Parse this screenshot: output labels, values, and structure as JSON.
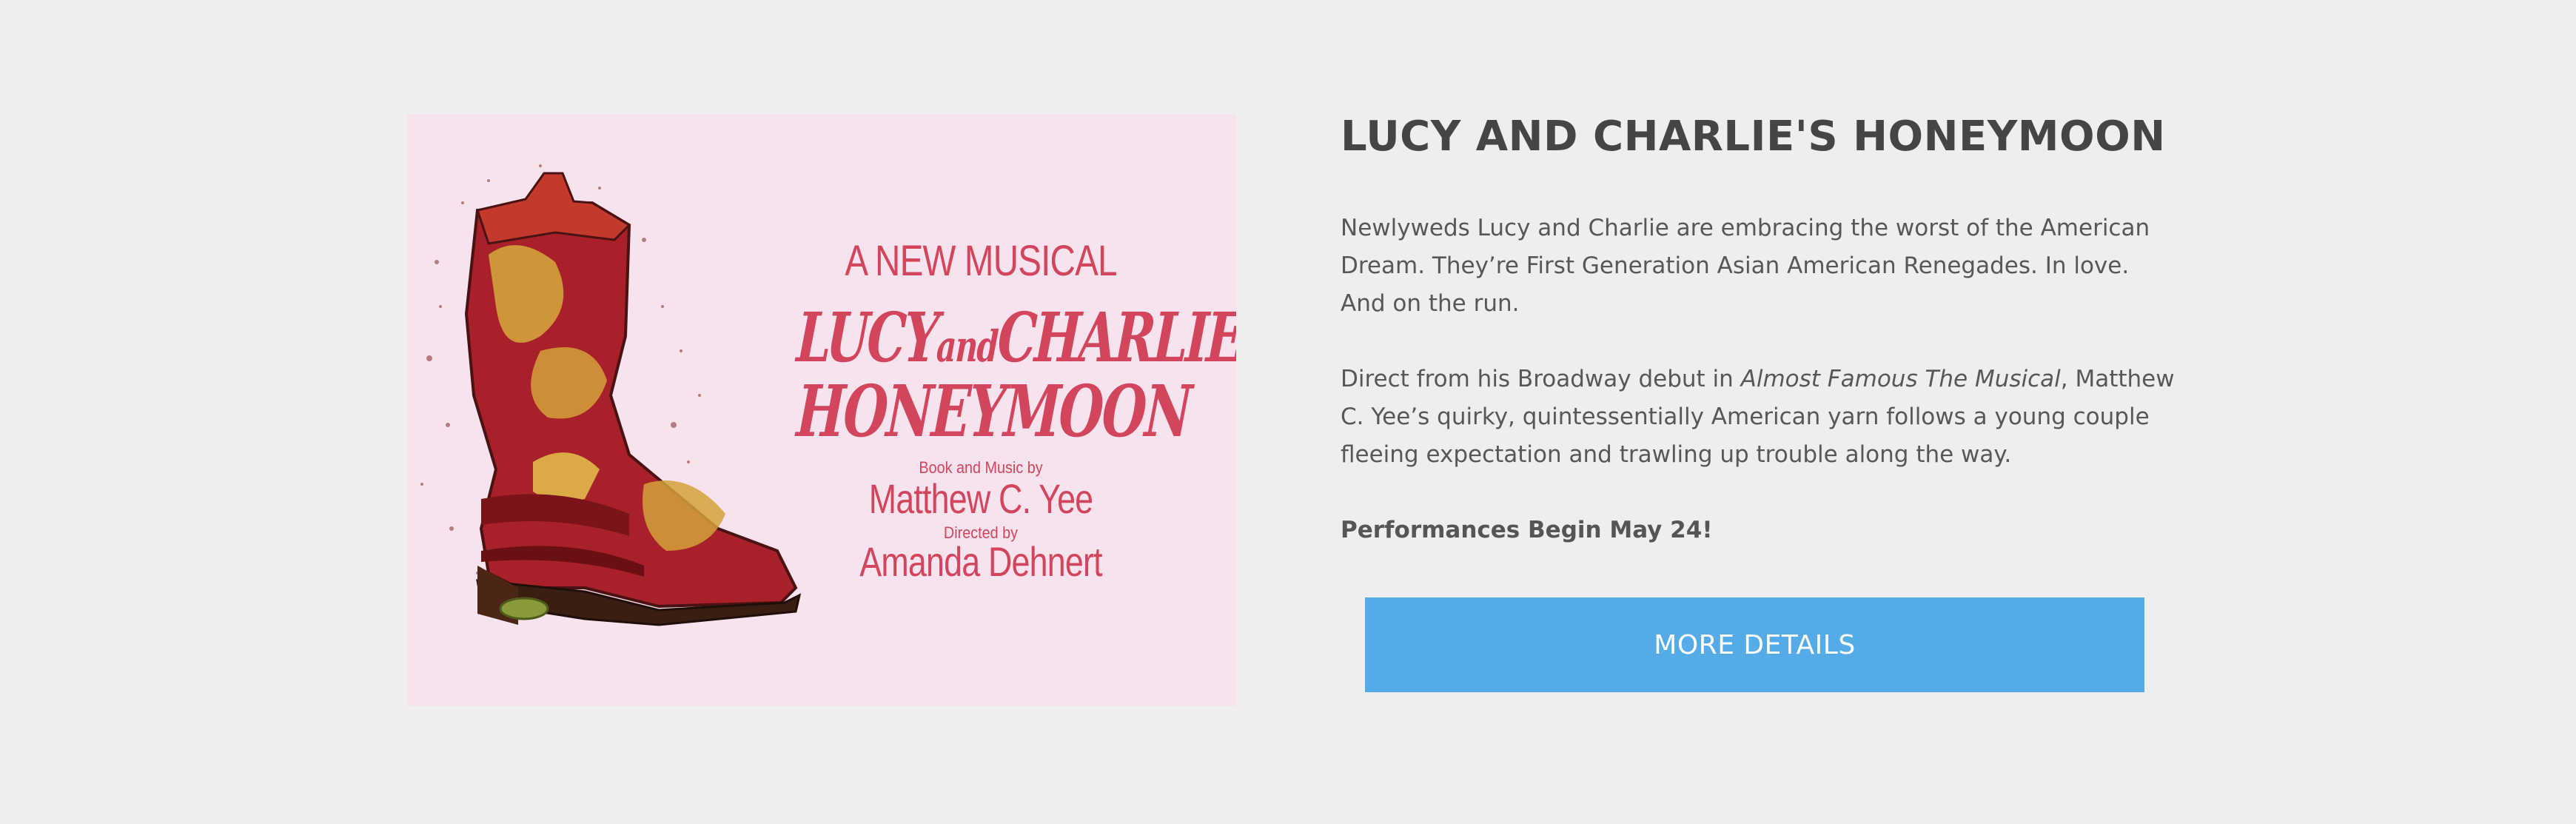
{
  "poster": {
    "tagline": "A NEW MUSICAL",
    "title_lucy": "LUCY",
    "title_and": "and",
    "title_charlies": "CHARLIE'S",
    "title_honeymoon": "HONEYMOON",
    "book_music_label": "Book and Music by",
    "book_music_credit": "Matthew C. Yee",
    "directed_label": "Directed by",
    "directed_credit": "Amanda Dehnert",
    "colors": {
      "background": "#f7e3ee",
      "text": "#d2455c",
      "boot_red": "#a8202a",
      "boot_gold": "#d4a23a"
    }
  },
  "show": {
    "title": "LUCY AND CHARLIE'S HONEYMOON",
    "paragraph1": "Newlyweds Lucy and Charlie are embracing the worst of the American Dream. They’re First Generation Asian American Renegades. In love. And on the run.",
    "paragraph2_before": "Direct from his Broadway debut in ",
    "paragraph2_italic": "Almost Famous The Musical",
    "paragraph2_after": ", Matthew C. Yee’s quirky, quintessentially American yarn follows a young couple fleeing expectation and trawling up trouble along the way.",
    "performances": "Performances Begin May 24!",
    "cta_label": "MORE DETAILS",
    "cta_color": "#55abe8"
  }
}
